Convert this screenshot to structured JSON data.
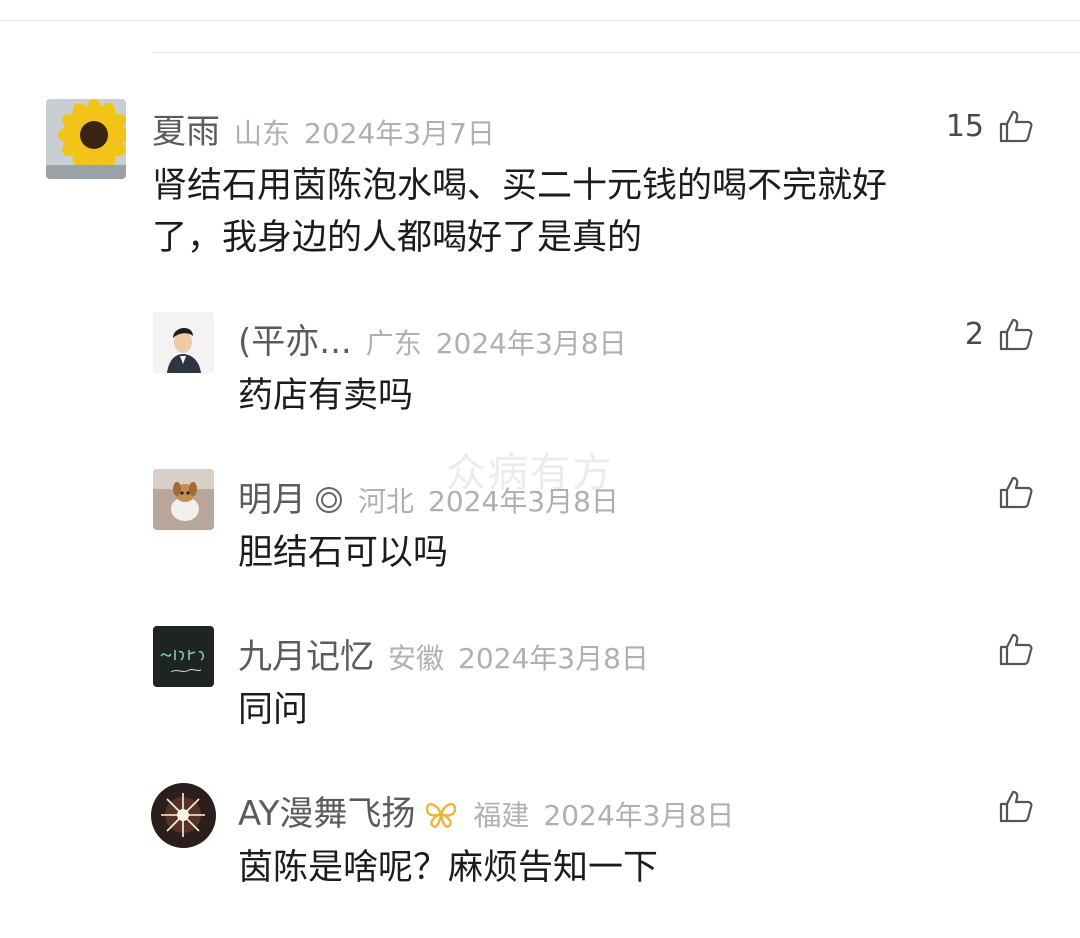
{
  "watermark": "众病有方",
  "comments": [
    {
      "username": "夏雨",
      "region": "山东",
      "date": "2024年3月7日",
      "likes": "15",
      "text_line1": "肾结石用茵陈泡水喝、买二十元钱的喝不完就好",
      "text_line2": "了，我身边的人都喝好了是真的",
      "avatar": "sunflower-avatar"
    },
    {
      "username": "(平亦...",
      "region": "广东",
      "date": "2024年3月8日",
      "likes": "2",
      "text": "药店有卖吗",
      "avatar": "man-avatar"
    },
    {
      "username": "明月",
      "badge_icon": "double-circle-icon",
      "region": "河北",
      "date": "2024年3月8日",
      "likes": "",
      "text": "胆结石可以吗",
      "avatar": "dog-avatar"
    },
    {
      "username": "九月记忆",
      "region": "安徽",
      "date": "2024年3月8日",
      "likes": "",
      "text": "同问",
      "avatar": "chalkboard-avatar"
    },
    {
      "username": "AY漫舞飞扬",
      "badge_icon": "butterfly-icon",
      "region": "福建",
      "date": "2024年3月8日",
      "likes": "",
      "text": "茵陈是啥呢？麻烦告知一下",
      "avatar": "sparkle-avatar"
    }
  ],
  "colors": {
    "username": "#5b5b5b",
    "meta": "#b0b0b0",
    "text": "#1c1c1c",
    "butterfly_badge": "#f0b43c"
  }
}
